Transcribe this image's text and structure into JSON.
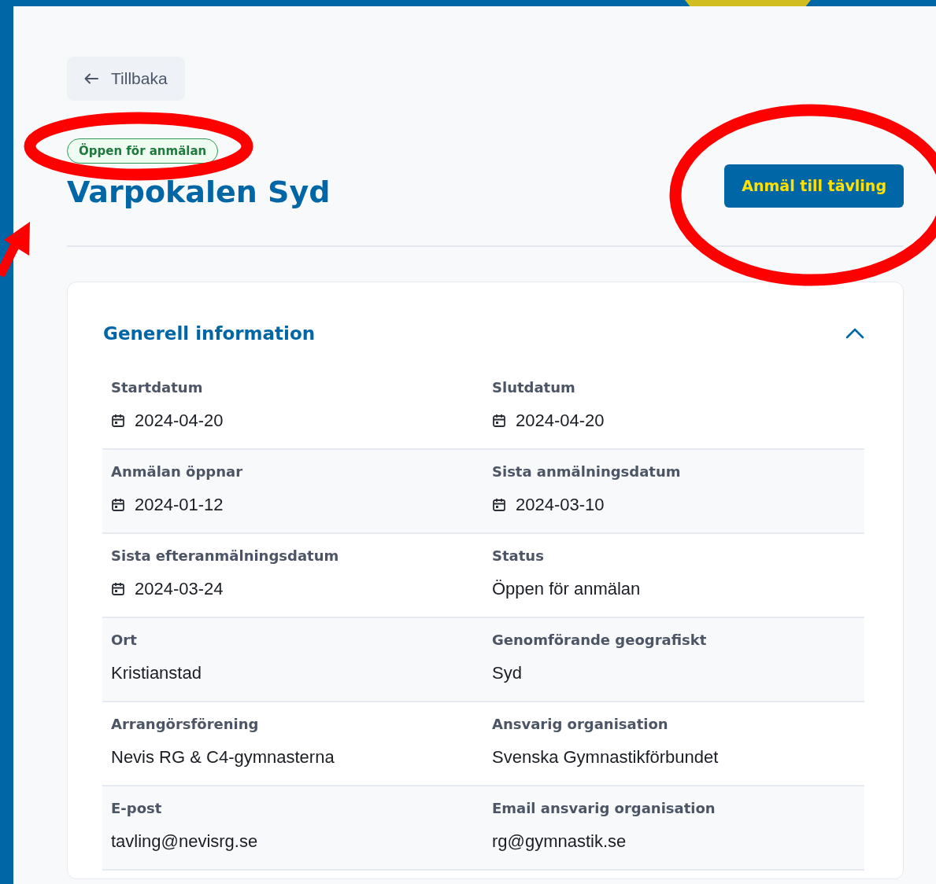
{
  "back_button": {
    "label": "Tillbaka"
  },
  "status_badge": "Öppen för anmälan",
  "title": "Varpokalen Syd",
  "register_button": "Anmäl till tävling",
  "section": {
    "title": "Generell information",
    "expanded": true,
    "rows": [
      [
        {
          "label": "Startdatum",
          "value": "2024-04-20",
          "kind": "date"
        },
        {
          "label": "Slutdatum",
          "value": "2024-04-20",
          "kind": "date"
        }
      ],
      [
        {
          "label": "Anmälan öppnar",
          "value": "2024-01-12",
          "kind": "date"
        },
        {
          "label": "Sista anmälningsdatum",
          "value": "2024-03-10",
          "kind": "date"
        }
      ],
      [
        {
          "label": "Sista efteranmälningsdatum",
          "value": "2024-03-24",
          "kind": "date"
        },
        {
          "label": "Status",
          "value": "Öppen för anmälan",
          "kind": "text"
        }
      ],
      [
        {
          "label": "Ort",
          "value": "Kristianstad",
          "kind": "text"
        },
        {
          "label": "Genomförande geografiskt",
          "value": "Syd",
          "kind": "text"
        }
      ],
      [
        {
          "label": "Arrangörsförening",
          "value": "Nevis RG & C4-gymnasterna",
          "kind": "text"
        },
        {
          "label": "Ansvarig organisation",
          "value": "Svenska Gymnastikförbundet",
          "kind": "text"
        }
      ],
      [
        {
          "label": "E-post",
          "value": "tavling@nevisrg.se",
          "kind": "text"
        },
        {
          "label": "Email ansvarig organisation",
          "value": "rg@gymnastik.se",
          "kind": "text"
        }
      ]
    ]
  }
}
